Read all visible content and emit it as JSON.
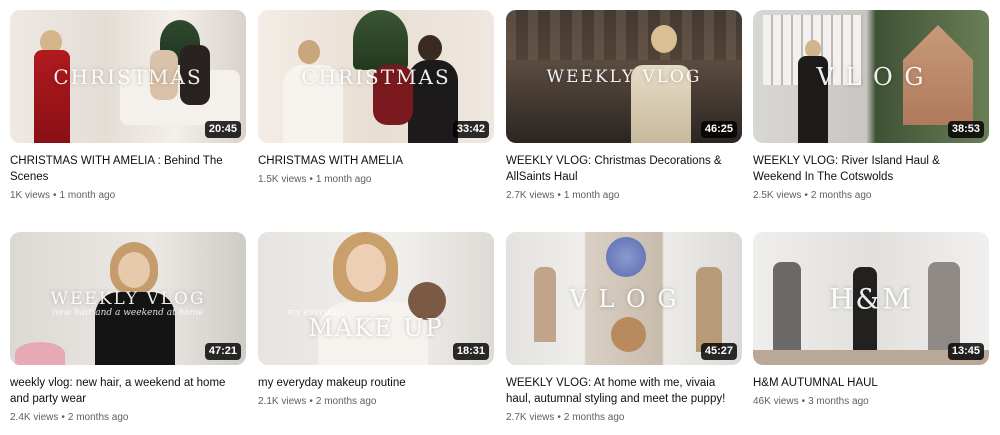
{
  "videos": [
    {
      "title": "CHRISTMAS WITH AMELIA : Behind The Scenes",
      "overlay": "CHRISTMAS",
      "duration": "20:45",
      "views": "1K views",
      "age": "1 month ago"
    },
    {
      "title": "CHRISTMAS WITH AMELIA",
      "overlay": "CHRISTMAS",
      "duration": "33:42",
      "views": "1.5K views",
      "age": "1 month ago"
    },
    {
      "title": "WEEKLY VLOG: Christmas Decorations & AllSaints Haul",
      "overlay": "WEEKLY VLOG",
      "duration": "46:25",
      "views": "2.7K views",
      "age": "1 month ago"
    },
    {
      "title": "WEEKLY VLOG: River Island Haul & Weekend In The Cotswolds",
      "overlay": "V L O G",
      "duration": "38:53",
      "views": "2.5K views",
      "age": "2 months ago"
    },
    {
      "title": "weekly vlog: new hair, a weekend at home and party wear",
      "overlay": "WEEKLY VLOG",
      "subtitle": "new hair and a weekend at home",
      "duration": "47:21",
      "views": "2.4K views",
      "age": "2 months ago"
    },
    {
      "title": "my everyday makeup routine",
      "overlay": "MAKE UP",
      "subtitle": "my everyday",
      "duration": "18:31",
      "views": "2.1K views",
      "age": "2 months ago"
    },
    {
      "title": "WEEKLY VLOG: At home with me, vivaia haul, autumnal styling and meet the puppy!",
      "overlay": "V L O G",
      "duration": "45:27",
      "views": "2.7K views",
      "age": "2 months ago"
    },
    {
      "title": "H&M AUTUMNAL HAUL",
      "overlay": "H&M",
      "duration": "13:45",
      "views": "46K views",
      "age": "3 months ago"
    }
  ]
}
